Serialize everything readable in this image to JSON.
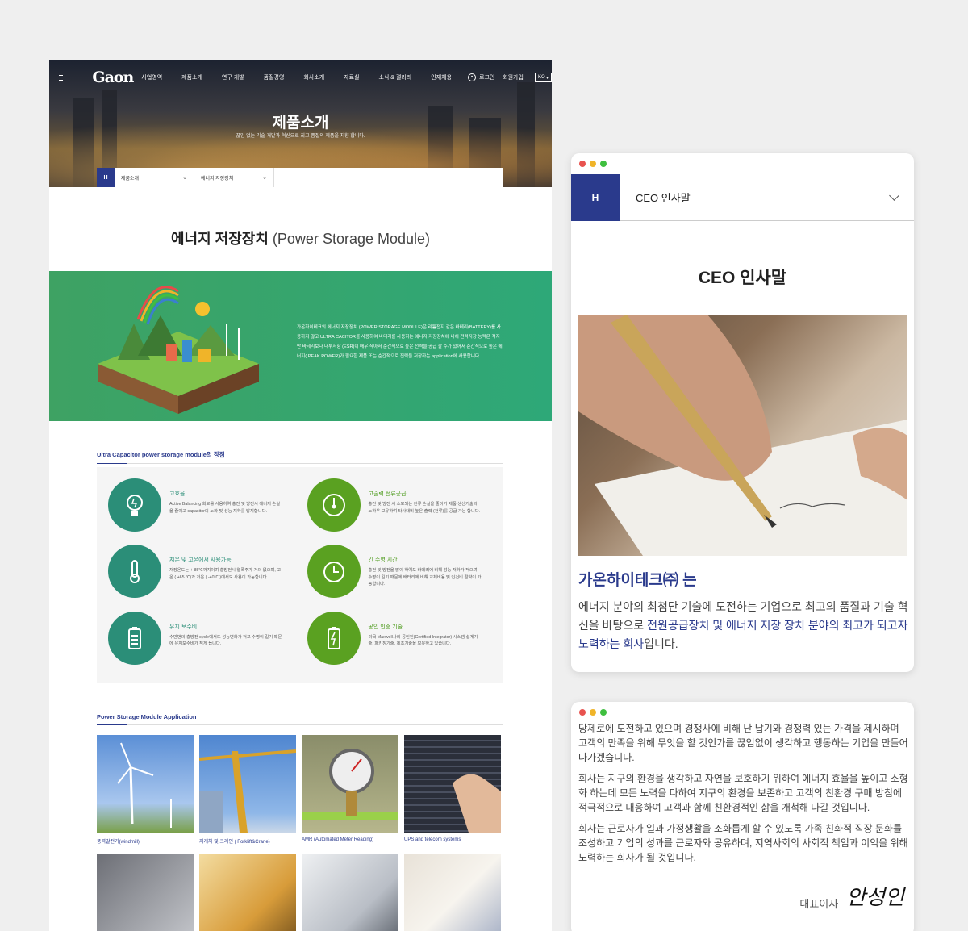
{
  "header": {
    "logo": "Gaon",
    "menu": [
      "사업영역",
      "제품소개",
      "연구 개발",
      "품질경영",
      "회사소개",
      "자료실",
      "소식 & 갤러리",
      "인재채용"
    ],
    "login": "로그인",
    "signup": "회원가입",
    "lang": "KO"
  },
  "hero": {
    "title": "제품소개",
    "subtitle": "끊임 없는 기술 개발과 혁신으로 최고 품질의 제품을 지향 합니다."
  },
  "subnav": {
    "home": "H",
    "dd1": "제품소개",
    "dd2": "에너지 저장장치"
  },
  "page": {
    "title_bold": "에너지 저장장치",
    "title_en": "(Power Storage Module)",
    "intro": "가온하이테크의 에너지 저장장치 (POWER STORAGE MODULE)은 리튬전지 같은 바테리(BATTERY)를 사용하지 않고 ULTRA CACITOR를 사용하여 바데리를 사용하는 에너지 저장장치에 비해 전력저장 능력은 적지만 바테리보다 내부저항 (ESR)이 매우 작아서 순간적으로 높은 전력을 공급 할 수가 있어서 순간적으로 높은 에너지( PEAK POWER)가 필요한 제품 또는 순간적으로 전력을 저장하는 application에 사용합니다."
  },
  "features": {
    "heading": "Ultra Capacitor power storage module의 장점",
    "items": [
      {
        "title": "고효율",
        "desc": "Active Balancing 회로를 사용하여 충전 및 방전시 에너지 손실을 줄이고 capacitor의 노화 및 성능 저하를 방지합니다.",
        "icon": "bulb-icon"
      },
      {
        "title": "고출력 전류공급",
        "desc": "충전 및 방전 시 소모되는 전류 손실을 줄이기 제품 생산기술의 노하우 보유하여 타사대비 높은 출력 (전류)를 공급 가능 합니다.",
        "icon": "gauge-icon"
      },
      {
        "title": "저온 및 고온에서 사용가능",
        "desc": "저장온도는 + 85℃까지이며 충방전시 열폭주가 거의 없으며, 고온 ( +65 ℃)과 저온 ( -40℃ )에서도 사용이 가능합니다.",
        "icon": "thermometer-icon"
      },
      {
        "title": "긴 수명 시간",
        "desc": "충전 및 방전을 많이 하여도 바데리에 비해 성능 저하가 적으며 수명이 길기 때문에 배터리에 비해 교체비용 및 인건비 절약이 가능합니다.",
        "icon": "clock-icon"
      },
      {
        "title": "유지 보수비",
        "desc": "수만번의 충방전 cycle에서도 성능변화가 적고 수명이 길기 때문에 유지보수비가 적게 듭니다.",
        "icon": "battery-icon"
      },
      {
        "title": "공인 인증 기술",
        "desc": "미국 Maxwell사의 공인된(Certified Integrator) 시스템 설계기술, 패키징기술, 제조기술을 보유하고 있습니다.",
        "icon": "battery-bolt-icon"
      }
    ]
  },
  "applications": {
    "heading": "Power Storage Module Application",
    "items": [
      {
        "caption": "풍력발전기(windmill)"
      },
      {
        "caption": "지게차 및 크레인 ( Forklift&Crane)"
      },
      {
        "caption": "AMR (Automated Meter Reading)"
      },
      {
        "caption": "UPS and telecom systems"
      },
      {
        "caption": ""
      },
      {
        "caption": ""
      },
      {
        "caption": ""
      },
      {
        "caption": ""
      }
    ]
  },
  "ceo_card": {
    "home": "H",
    "dropdown": "CEO 인사말",
    "title": "CEO 인사말",
    "company": "가온하이테크㈜ 는",
    "desc_1": "에너지 분야의 최첨단 기술에 도전하는 기업으로 최고의 품질과 기술 혁신을 바탕으로 ",
    "desc_hl": "전원공급장치 및 에너지 저장 장치 분야의 최고가 되고자 노력하는 회사",
    "desc_2": "입니다."
  },
  "ceo_card2": {
    "p1": "당제로에 도전하고 있으며 경쟁사에 비해 난 납기와 경쟁력 있는 가격을 제시하며 고객의 만족을 위해 무엇을 할 것인가를 끊임없이 생각하고 행동하는 기업을 만들어 나가겠습니다.",
    "p2": "회사는 지구의 환경을 생각하고 자연을 보호하기 위하여 에너지 효율을 높이고 소형화 하는데 모든 노력을 다하여 지구의 환경을 보존하고 고객의 친환경 구매 방침에 적극적으로 대응하여 고객과 함께 친환경적인 삶을 개척해 나갈 것입니다.",
    "p3": "회사는 근로자가 일과 가정생활을 조화롭게 할 수 있도록 가족 친화적 직장 문화를 조성하고 기업의 성과를 근로자와 공유하며, 지역사회의 사회적 책임과 이익을 위해 노력하는 회사가 될 것입니다.",
    "role": "대표이사",
    "signature": "안성인"
  },
  "colors": {
    "brand_navy": "#2a3a8c",
    "teal": "#2b8e78",
    "green": "#5aa121",
    "banner_green": "#3ea263",
    "dot_red": "#e8534f",
    "dot_yellow": "#f0b429",
    "dot_green": "#3fbf3f"
  }
}
